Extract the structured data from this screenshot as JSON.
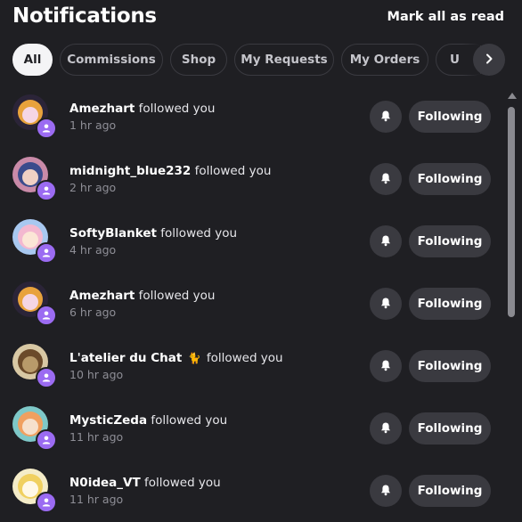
{
  "header": {
    "title": "Notifications",
    "mark_all": "Mark all as read"
  },
  "tabs": [
    {
      "label": "All",
      "active": true
    },
    {
      "label": "Commissions",
      "active": false
    },
    {
      "label": "Shop",
      "active": false
    },
    {
      "label": "My Requests",
      "active": false
    },
    {
      "label": "My Orders",
      "active": false
    },
    {
      "label": "U",
      "active": false
    }
  ],
  "notifications": [
    {
      "user": "Amezhart",
      "action": "followed you",
      "emoji": "",
      "time": "1 hr ago",
      "button": "Following",
      "avatar_colors": [
        "#2b2438",
        "#e8a23c",
        "#f5d6e4"
      ]
    },
    {
      "user": "midnight_blue232",
      "action": "followed you",
      "emoji": "",
      "time": "2 hr ago",
      "button": "Following",
      "avatar_colors": [
        "#c98aa8",
        "#3b4b8c",
        "#f0d0c4"
      ]
    },
    {
      "user": "SoftyBlanket",
      "action": "followed you",
      "emoji": "",
      "time": "4 hr ago",
      "button": "Following",
      "avatar_colors": [
        "#a8c8f0",
        "#f3b8d0",
        "#fbe6d6"
      ]
    },
    {
      "user": "Amezhart",
      "action": "followed you",
      "emoji": "",
      "time": "6 hr ago",
      "button": "Following",
      "avatar_colors": [
        "#2b2438",
        "#e8a23c",
        "#f5d6e4"
      ]
    },
    {
      "user": "L'atelier du Chat",
      "action": "followed you",
      "emoji": "🐈",
      "time": "10 hr ago",
      "button": "Following",
      "avatar_colors": [
        "#d8c8a4",
        "#6b4a2a",
        "#b89a6a"
      ]
    },
    {
      "user": "MysticZeda",
      "action": "followed you",
      "emoji": "",
      "time": "11 hr ago",
      "button": "Following",
      "avatar_colors": [
        "#7ec8c8",
        "#f0a060",
        "#f6e0cc"
      ]
    },
    {
      "user": "N0idea_VT",
      "action": "followed you",
      "emoji": "",
      "time": "11 hr ago",
      "button": "Following",
      "avatar_colors": [
        "#f4ecc8",
        "#f0d060",
        "#fff8e6"
      ]
    }
  ],
  "colors": {
    "background": "#1f1f23",
    "badge": "#9b6bf2",
    "button": "#3a3a40",
    "muted_text": "#8e8e96"
  },
  "icons": {
    "badge": "person-icon",
    "bell": "bell-icon",
    "next": "chevron-right-icon"
  }
}
